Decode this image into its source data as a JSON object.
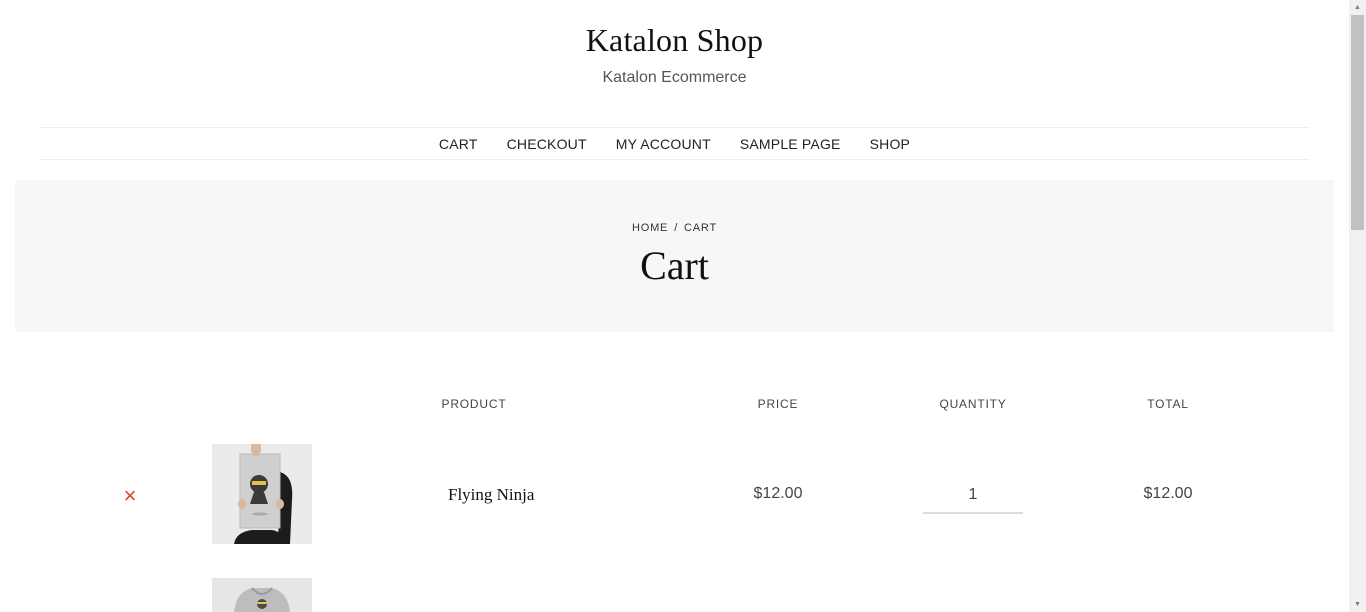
{
  "site": {
    "title": "Katalon Shop",
    "tagline": "Katalon Ecommerce"
  },
  "nav": {
    "items": [
      "Cart",
      "Checkout",
      "My Account",
      "Sample Page",
      "Shop"
    ]
  },
  "hero": {
    "breadcrumb": {
      "home": "Home",
      "separator": "/",
      "current": "Cart"
    },
    "title": "Cart"
  },
  "cart": {
    "headers": {
      "product": "Product",
      "price": "Price",
      "quantity": "Quantity",
      "total": "Total"
    },
    "items": [
      {
        "name": "Flying Ninja",
        "price": "$12.00",
        "quantity": "1",
        "total": "$12.00",
        "remove_icon": "×"
      }
    ]
  },
  "colors": {
    "accent_remove": "#e2401c",
    "hero_bg": "#f7f7f7"
  }
}
